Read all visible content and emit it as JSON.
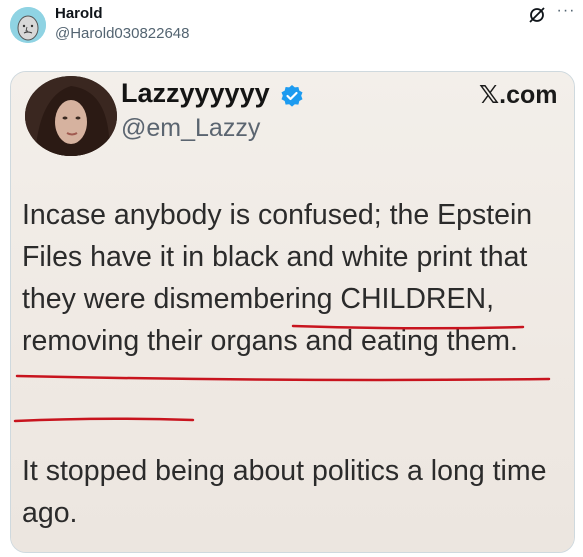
{
  "post": {
    "author_name": "Harold",
    "author_handle": "@Harold030822648",
    "more_icon": "more-icon",
    "grok_icon": "grok-icon"
  },
  "media": {
    "inner_author_name": "Lazzyyyyyy",
    "inner_author_handle": "@em_Lazzy",
    "brand": ".com",
    "verified_icon": "verified-badge-icon",
    "paragraph1": "Incase anybody is confused; the Epstein Files have it in black and white print that they were dismembering CHILDREN, removing their organs and eating them.",
    "paragraph2": "It stopped being about politics a long time ago.",
    "underline_color": "#c8141e"
  }
}
